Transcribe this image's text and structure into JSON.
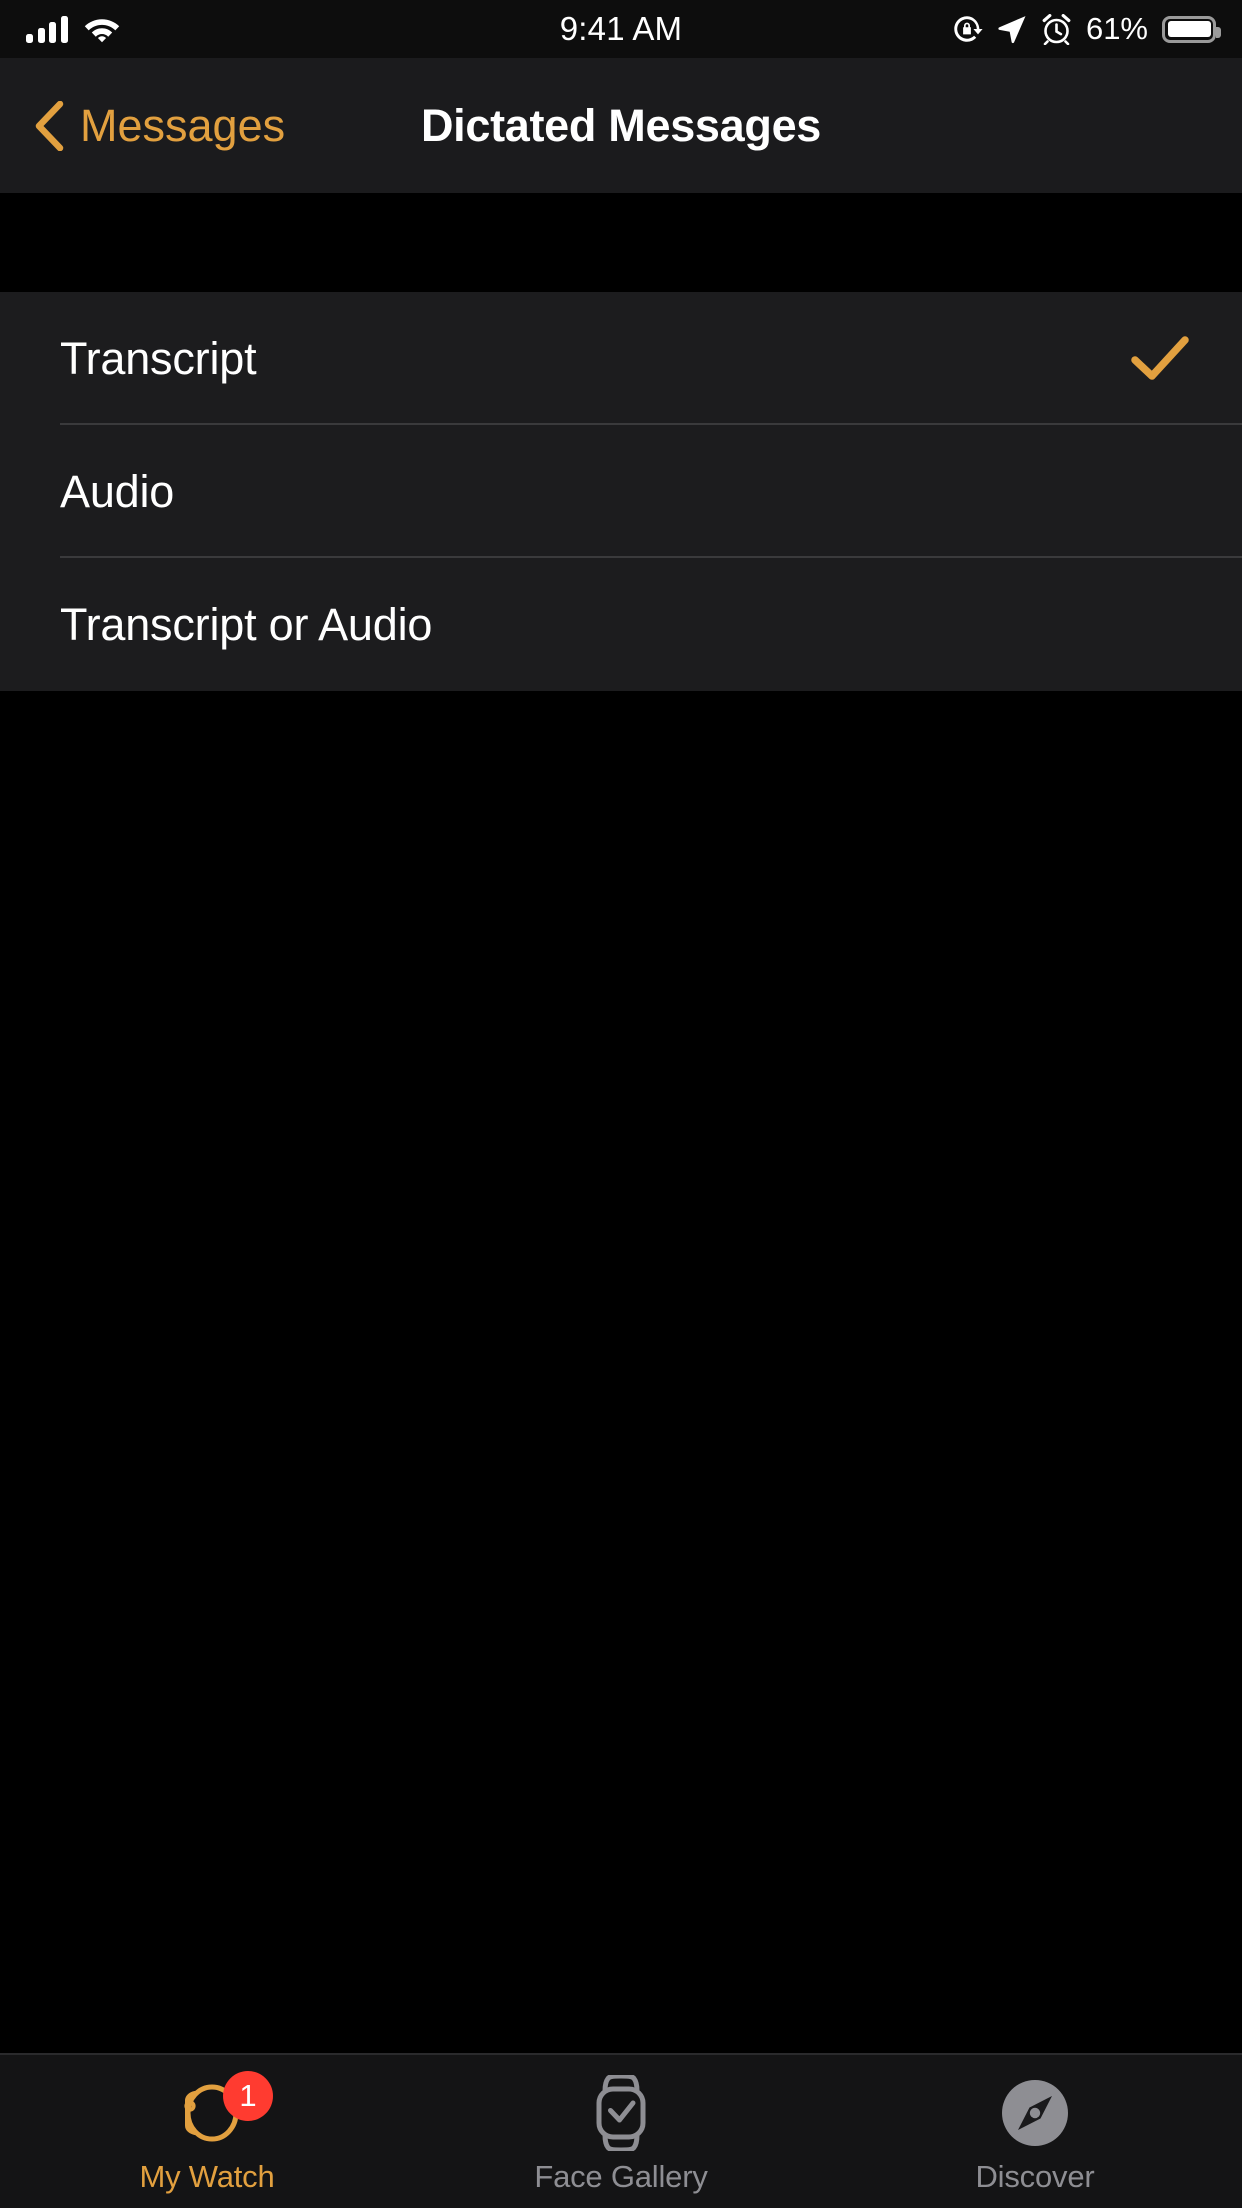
{
  "status_bar": {
    "time": "9:41 AM",
    "battery_percent": "61%",
    "icons": [
      "signal-bars-icon",
      "wifi-icon",
      "rotation-lock-icon",
      "location-arrow-icon",
      "alarm-clock-icon",
      "battery-icon"
    ]
  },
  "nav": {
    "back_label": "Messages",
    "title": "Dictated Messages",
    "accent_color": "#e2a03f"
  },
  "list": {
    "rows": [
      {
        "label": "Transcript",
        "selected": true
      },
      {
        "label": "Audio",
        "selected": false
      },
      {
        "label": "Transcript or Audio",
        "selected": false
      }
    ]
  },
  "tab_bar": {
    "tabs": [
      {
        "label": "My Watch",
        "icon": "watch-side-icon",
        "active": true,
        "badge": "1"
      },
      {
        "label": "Face Gallery",
        "icon": "watch-face-icon",
        "active": false,
        "badge": ""
      },
      {
        "label": "Discover",
        "icon": "compass-icon",
        "active": false,
        "badge": ""
      }
    ]
  }
}
